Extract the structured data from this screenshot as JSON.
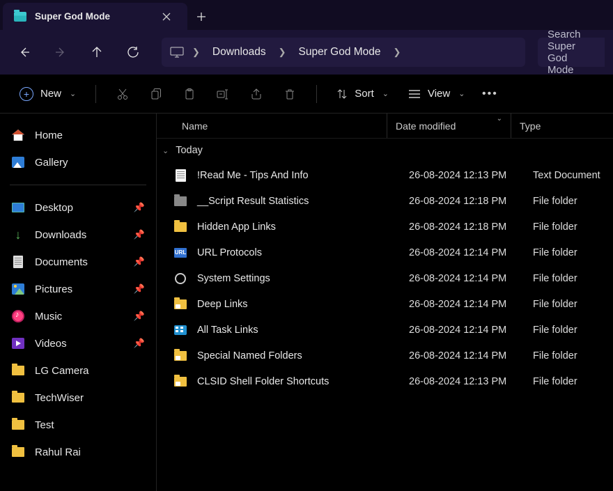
{
  "tab": {
    "title": "Super God Mode"
  },
  "breadcrumb": {
    "items": [
      "Downloads",
      "Super God Mode"
    ]
  },
  "search": {
    "placeholder": "Search Super God Mode"
  },
  "toolbar": {
    "new_label": "New",
    "sort_label": "Sort",
    "view_label": "View"
  },
  "sidebar": {
    "top": [
      {
        "label": "Home",
        "icon": "home-icon"
      },
      {
        "label": "Gallery",
        "icon": "gallery-icon"
      }
    ],
    "pinned": [
      {
        "label": "Desktop",
        "icon": "desktop-icon",
        "pinned": true
      },
      {
        "label": "Downloads",
        "icon": "downloads-icon",
        "pinned": true
      },
      {
        "label": "Documents",
        "icon": "documents-icon",
        "pinned": true
      },
      {
        "label": "Pictures",
        "icon": "pictures-icon",
        "pinned": true
      },
      {
        "label": "Music",
        "icon": "music-icon",
        "pinned": true
      },
      {
        "label": "Videos",
        "icon": "videos-icon",
        "pinned": true
      },
      {
        "label": "LG Camera",
        "icon": "folder-icon",
        "pinned": false
      },
      {
        "label": "TechWiser",
        "icon": "folder-icon",
        "pinned": false
      },
      {
        "label": "Test",
        "icon": "folder-icon",
        "pinned": false
      },
      {
        "label": "Rahul Rai",
        "icon": "folder-icon",
        "pinned": false
      }
    ]
  },
  "columns": {
    "name": "Name",
    "date": "Date modified",
    "type": "Type"
  },
  "group_label": "Today",
  "files": [
    {
      "icon": "text-file-icon",
      "name": "!Read Me - Tips And Info",
      "date": "26-08-2024 12:13 PM",
      "type": "Text Document"
    },
    {
      "icon": "folder-grey-icon",
      "name": "__Script Result Statistics",
      "date": "26-08-2024 12:18 PM",
      "type": "File folder"
    },
    {
      "icon": "folder-icon",
      "name": "Hidden App Links",
      "date": "26-08-2024 12:18 PM",
      "type": "File folder"
    },
    {
      "icon": "url-folder-icon",
      "name": "URL Protocols",
      "date": "26-08-2024 12:14 PM",
      "type": "File folder"
    },
    {
      "icon": "settings-folder-icon",
      "name": "System Settings",
      "date": "26-08-2024 12:14 PM",
      "type": "File folder"
    },
    {
      "icon": "folder-badge-icon",
      "name": "Deep Links",
      "date": "26-08-2024 12:14 PM",
      "type": "File folder"
    },
    {
      "icon": "tasks-folder-icon",
      "name": "All Task Links",
      "date": "26-08-2024 12:14 PM",
      "type": "File folder"
    },
    {
      "icon": "folder-badge-icon",
      "name": "Special Named Folders",
      "date": "26-08-2024 12:14 PM",
      "type": "File folder"
    },
    {
      "icon": "folder-badge-icon",
      "name": "CLSID Shell Folder Shortcuts",
      "date": "26-08-2024 12:13 PM",
      "type": "File folder"
    }
  ]
}
